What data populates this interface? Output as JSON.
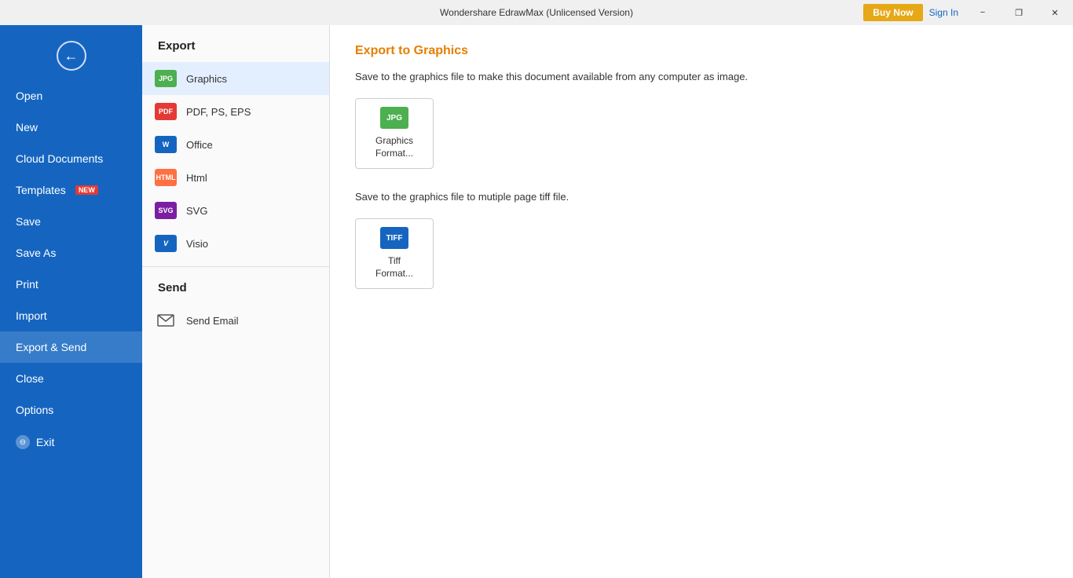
{
  "titlebar": {
    "title": "Wondershare EdrawMax (Unlicensed Version)",
    "buy_now_label": "Buy Now",
    "sign_in_label": "Sign In",
    "minimize_label": "−",
    "restore_label": "❐",
    "close_label": "✕"
  },
  "sidebar": {
    "back_icon": "←",
    "items": [
      {
        "id": "open",
        "label": "Open",
        "badge": null
      },
      {
        "id": "new",
        "label": "New",
        "badge": null
      },
      {
        "id": "cloud-documents",
        "label": "Cloud Documents",
        "badge": null
      },
      {
        "id": "templates",
        "label": "Templates",
        "badge": "NEW"
      },
      {
        "id": "save",
        "label": "Save",
        "badge": null
      },
      {
        "id": "save-as",
        "label": "Save As",
        "badge": null
      },
      {
        "id": "print",
        "label": "Print",
        "badge": null
      },
      {
        "id": "import",
        "label": "Import",
        "badge": null
      },
      {
        "id": "export-send",
        "label": "Export & Send",
        "badge": null,
        "active": true
      },
      {
        "id": "close",
        "label": "Close",
        "badge": null
      },
      {
        "id": "options",
        "label": "Options",
        "badge": null
      },
      {
        "id": "exit",
        "label": "Exit",
        "badge": null,
        "has_icon": true
      }
    ]
  },
  "export_panel": {
    "export_section_title": "Export",
    "export_items": [
      {
        "id": "graphics",
        "label": "Graphics",
        "icon_text": "JPG",
        "icon_class": "icon-jpg",
        "active": true
      },
      {
        "id": "pdf",
        "label": "PDF, PS, EPS",
        "icon_text": "PDF",
        "icon_class": "icon-pdf"
      },
      {
        "id": "office",
        "label": "Office",
        "icon_text": "W",
        "icon_class": "icon-word"
      },
      {
        "id": "html",
        "label": "Html",
        "icon_text": "HTML",
        "icon_class": "icon-html"
      },
      {
        "id": "svg",
        "label": "SVG",
        "icon_text": "SVG",
        "icon_class": "icon-svg"
      },
      {
        "id": "visio",
        "label": "Visio",
        "icon_text": "V",
        "icon_class": "icon-visio"
      }
    ],
    "send_section_title": "Send",
    "send_items": [
      {
        "id": "send-email",
        "label": "Send Email"
      }
    ]
  },
  "right_panel": {
    "title": "Export to Graphics",
    "desc1": "Save to the graphics file to make this document available from any computer as image.",
    "desc2": "Save to the graphics file to mutiple page tiff file.",
    "format_cards": [
      {
        "id": "graphics-format",
        "icon_text": "JPG",
        "icon_class": "card-icon-jpg",
        "label": "Graphics\nFormat..."
      },
      {
        "id": "tiff-format",
        "icon_text": "TIFF",
        "icon_class": "card-icon-tiff",
        "label": "Tiff\nFormat..."
      }
    ]
  },
  "colors": {
    "sidebar_bg": "#1565c0",
    "accent_orange": "#e67e00",
    "new_badge_bg": "#e53935",
    "buy_now_bg": "#e6a817"
  }
}
